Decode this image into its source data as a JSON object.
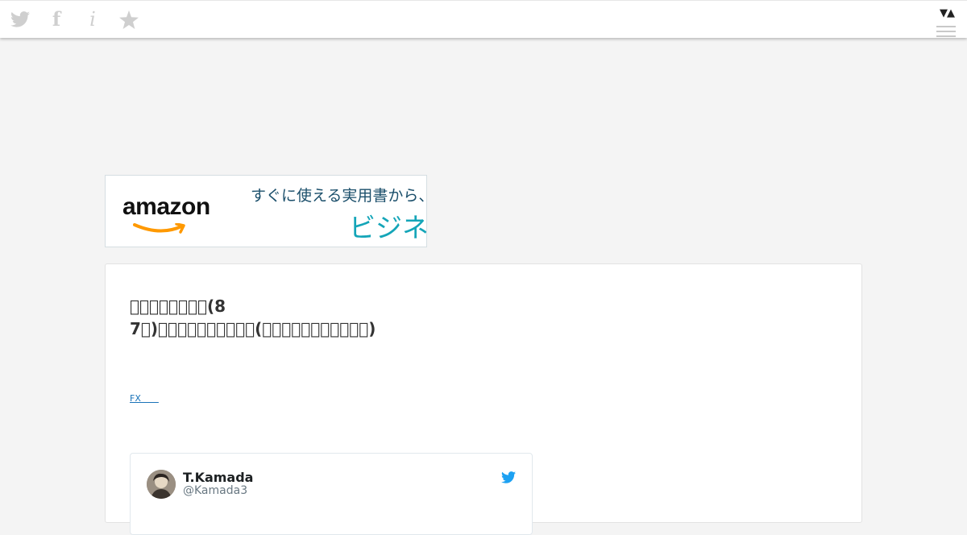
{
  "topbar": {
    "icons": [
      "twitter-icon",
      "facebook-icon",
      "info-icon",
      "star-icon"
    ],
    "facebook_glyph": "f",
    "info_glyph": "i",
    "updown_label": "▼▲"
  },
  "ad": {
    "brand": "amazon",
    "line1": "すぐに使える実用書から、話",
    "line2": "ビジネス"
  },
  "article": {
    "title": "\u0000\u0000\u0000\u0000\u0000\u0000\u0000\u0000(87\u0000)\u0000\u0000\u0000\u0000\u0000\u0000\u0000\u0000\u0000\u0000(\u0000\u0000\u0000\u0000\u0000\u0000\u0000\u0000\u0000\u0000\u0000)",
    "tag": "FX　　"
  },
  "tweet": {
    "name": "T.Kamada",
    "handle": "@Kamada3"
  },
  "colors": {
    "background": "#f4f4f4",
    "link": "#1a73b9",
    "twitter_blue": "#1da1f2",
    "icon_gray": "#cfcfcf",
    "amazon_orange": "#f90"
  }
}
